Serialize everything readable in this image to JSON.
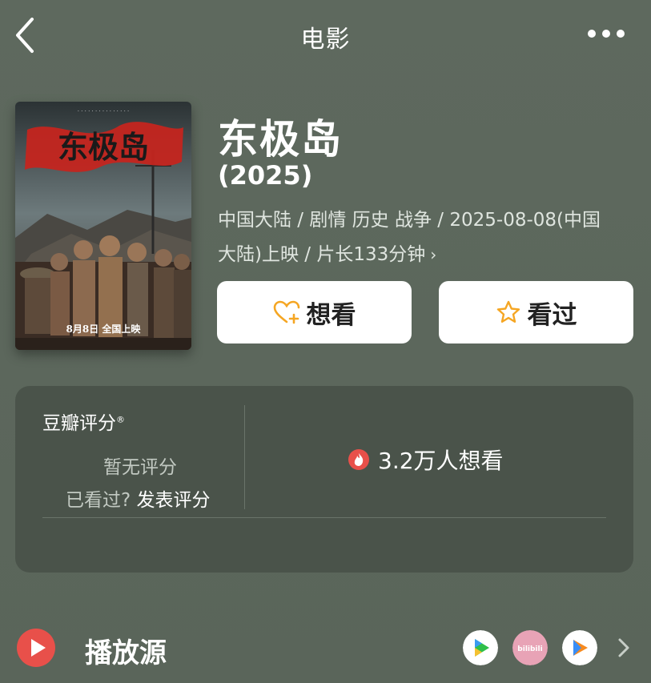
{
  "nav": {
    "title": "电影",
    "back_icon": "chevron-left-icon",
    "more_icon": "more-dots-icon"
  },
  "movie": {
    "title": "东极岛",
    "year": "(2025)",
    "meta_line1": "中国大陆 / 剧情 历史 战争 / 2025-08-08(中国",
    "meta_line2": "大陆)上映 / 片长133分钟",
    "meta_arrow": "›",
    "poster": {
      "title_art": "东极岛",
      "release_text": "8月8日 全国上映"
    }
  },
  "actions": {
    "want_label": "想看",
    "want_icon": "heart-plus-icon",
    "seen_label": "看过",
    "seen_icon": "star-outline-icon"
  },
  "rating": {
    "label": "豆瓣评分",
    "label_mark": "®",
    "no_rating": "暂无评分",
    "seen_question": "已看过?",
    "post_rating": "发表评分",
    "wish_count": "3.2万人想看",
    "wish_icon": "flame-icon"
  },
  "play": {
    "label": "播放源",
    "icon": "play-circle-icon",
    "sources": [
      "iqiyi-style-icon",
      "bilibili-icon",
      "tencent-video-icon"
    ],
    "bilibili_text": "bilibili"
  },
  "colors": {
    "background": "#5e695e",
    "card": "#4a534a",
    "accent_orange": "#f5a623",
    "play_red": "#e8504a"
  }
}
